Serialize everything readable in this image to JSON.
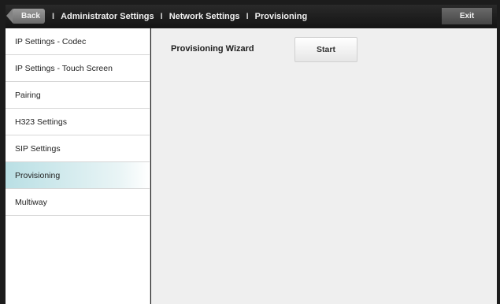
{
  "header": {
    "back_label": "Back",
    "breadcrumbs": [
      "Administrator Settings",
      "Network Settings",
      "Provisioning"
    ],
    "separator": "I",
    "exit_label": "Exit"
  },
  "sidebar": {
    "items": [
      {
        "label": "IP Settings - Codec",
        "active": false
      },
      {
        "label": "IP Settings - Touch Screen",
        "active": false
      },
      {
        "label": "Pairing",
        "active": false
      },
      {
        "label": "H323 Settings",
        "active": false
      },
      {
        "label": "SIP Settings",
        "active": false
      },
      {
        "label": "Provisioning",
        "active": true
      },
      {
        "label": "Multiway",
        "active": false
      }
    ]
  },
  "main": {
    "wizard_label": "Provisioning Wizard",
    "start_label": "Start"
  },
  "colors": {
    "active_item": "#b9dfe4",
    "content_bg": "#efefef"
  }
}
